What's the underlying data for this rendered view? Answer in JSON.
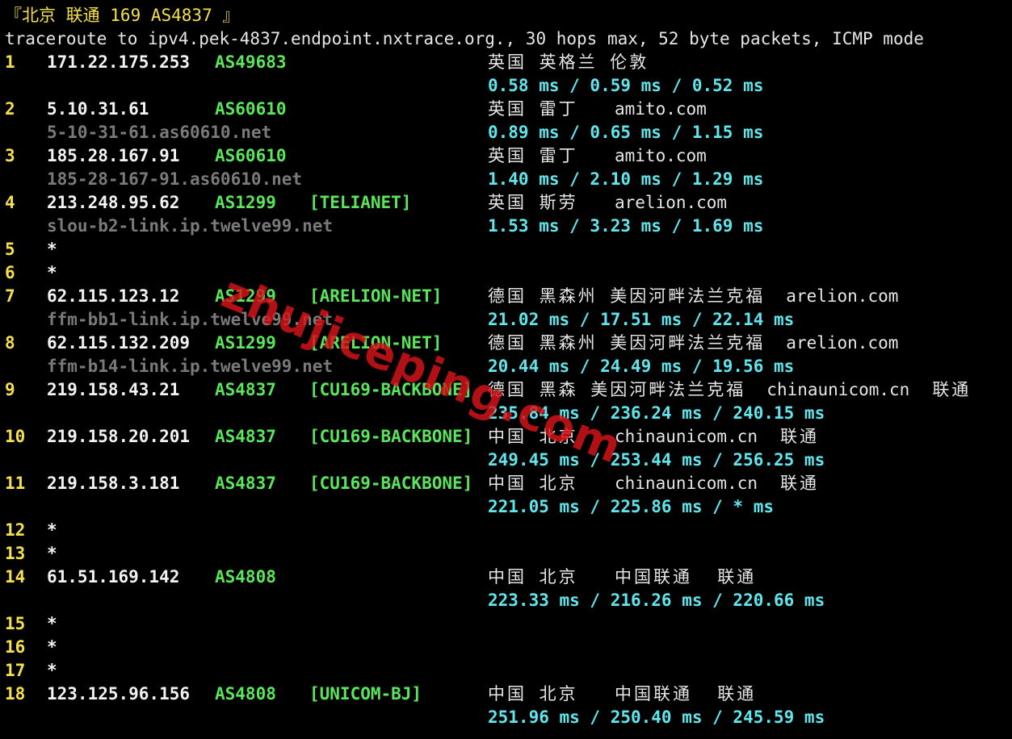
{
  "header": {
    "title": "『北京 联通 169 AS4837 』",
    "command": "traceroute to ipv4.pek-4837.endpoint.nxtrace.org., 30 hops max, 52 byte packets, ICMP mode"
  },
  "hops": [
    {
      "n": "1",
      "ip": "171.22.175.253",
      "asn": "AS49683",
      "tag": "",
      "geo": "英国 英格兰 伦敦",
      "domain": "",
      "isp": "",
      "rdns": "",
      "rtt": "0.58 ms / 0.59 ms / 0.52 ms"
    },
    {
      "n": "2",
      "ip": "5.10.31.61",
      "asn": "AS60610",
      "tag": "",
      "geo": "英国 雷丁",
      "domain": "amito.com",
      "isp": "",
      "rdns": "5-10-31-61.as60610.net",
      "rtt": "0.89 ms / 0.65 ms / 1.15 ms"
    },
    {
      "n": "3",
      "ip": "185.28.167.91",
      "asn": "AS60610",
      "tag": "",
      "geo": "英国 雷丁",
      "domain": "amito.com",
      "isp": "",
      "rdns": "185-28-167-91.as60610.net",
      "rtt": "1.40 ms / 2.10 ms / 1.29 ms"
    },
    {
      "n": "4",
      "ip": "213.248.95.62",
      "asn": "AS1299",
      "tag": "[TELIANET]",
      "geo": "英国 斯劳",
      "domain": "arelion.com",
      "isp": "",
      "rdns": "slou-b2-link.ip.twelve99.net",
      "rtt": "1.53 ms / 3.23 ms / 1.69 ms"
    },
    {
      "n": "5",
      "ip": "*"
    },
    {
      "n": "6",
      "ip": "*"
    },
    {
      "n": "7",
      "ip": "62.115.123.12",
      "asn": "AS1299",
      "tag": "[ARELION-NET]",
      "geo": "德国 黑森州 美因河畔法兰克福",
      "domain": "arelion.com",
      "isp": "",
      "rdns": "ffm-bb1-link.ip.twelve99.net",
      "rtt": "21.02 ms / 17.51 ms / 22.14 ms"
    },
    {
      "n": "8",
      "ip": "62.115.132.209",
      "asn": "AS1299",
      "tag": "[ARELION-NET]",
      "geo": "德国 黑森州 美因河畔法兰克福",
      "domain": "arelion.com",
      "isp": "",
      "rdns": "ffm-b14-link.ip.twelve99.net",
      "rtt": "20.44 ms / 24.49 ms / 19.56 ms"
    },
    {
      "n": "9",
      "ip": "219.158.43.21",
      "asn": "AS4837",
      "tag": "[CU169-BACKBONE]",
      "geo": "德国 黑森 美因河畔法兰克福",
      "domain": "chinaunicom.cn",
      "isp": "联通",
      "rdns": "",
      "rtt": "235.84 ms / 236.24 ms / 240.15 ms"
    },
    {
      "n": "10",
      "ip": "219.158.20.201",
      "asn": "AS4837",
      "tag": "[CU169-BACKBONE]",
      "geo": "中国 北京",
      "domain": "chinaunicom.cn",
      "isp": "联通",
      "rdns": "",
      "rtt": "249.45 ms / 253.44 ms / 256.25 ms"
    },
    {
      "n": "11",
      "ip": "219.158.3.181",
      "asn": "AS4837",
      "tag": "[CU169-BACKBONE]",
      "geo": "中国 北京",
      "domain": "chinaunicom.cn",
      "isp": "联通",
      "rdns": "",
      "rtt": "221.05 ms / 225.86 ms / * ms"
    },
    {
      "n": "12",
      "ip": "*"
    },
    {
      "n": "13",
      "ip": "*"
    },
    {
      "n": "14",
      "ip": "61.51.169.142",
      "asn": "AS4808",
      "tag": "",
      "geo": "中国 北京",
      "domain": "",
      "isp": "中国联通  联通",
      "rdns": "",
      "rtt": "223.33 ms / 216.26 ms / 220.66 ms"
    },
    {
      "n": "15",
      "ip": "*"
    },
    {
      "n": "16",
      "ip": "*"
    },
    {
      "n": "17",
      "ip": "*"
    },
    {
      "n": "18",
      "ip": "123.125.96.156",
      "asn": "AS4808",
      "tag": "[UNICOM-BJ]",
      "geo": "中国 北京",
      "domain": "",
      "isp": "中国联通  联通",
      "rdns": "",
      "rtt": "251.96 ms / 250.40 ms / 245.59 ms"
    }
  ],
  "watermark": "zhujiceping.com",
  "colors": {
    "background": "#000000",
    "hop": "#f4e04b",
    "asn": "#59e65a",
    "rtt": "#5fe6ec",
    "rdns": "#7a7a7a",
    "watermark": "#d8141a"
  }
}
